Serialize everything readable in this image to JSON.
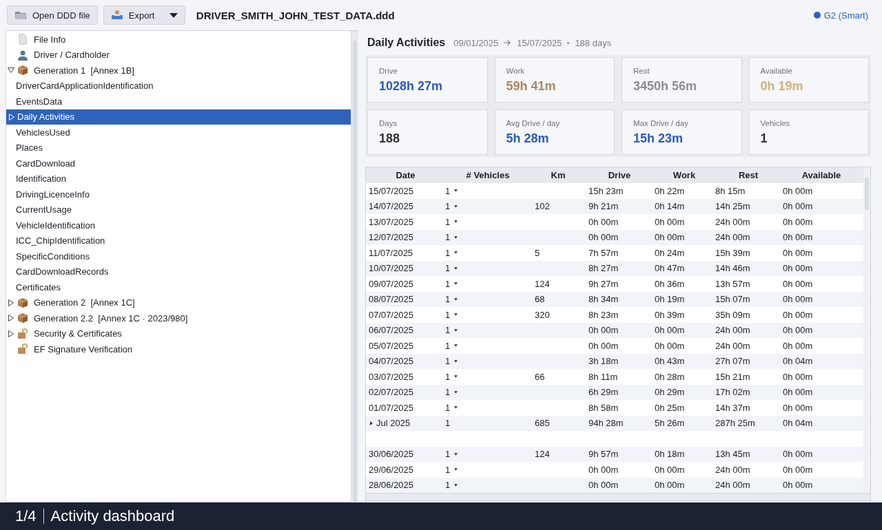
{
  "toolbar": {
    "buttons": [
      {
        "kind": "open",
        "label": "Open DDD file"
      },
      {
        "kind": "export",
        "label": "Export"
      }
    ],
    "file_name": "DRIVER_SMITH_JOHN_TEST_DATA.ddd",
    "card_type": {
      "label": "G2 (Smart)",
      "color": "#2a5fc4"
    }
  },
  "tree": [
    {
      "kind": "file",
      "label": "File Info",
      "selected": false
    },
    {
      "kind": "person",
      "label": "Driver / Cardholder",
      "selected": false
    },
    {
      "kind": "package",
      "label": "Generation 1  [Annex 1B]",
      "selected": false,
      "expanded": true,
      "children": [
        {
          "label": "DriverCardApplicationIdentification",
          "selected": false
        },
        {
          "label": "EventsData",
          "selected": false
        },
        {
          "label": "Daily Activities",
          "selected": true,
          "expanded": false
        },
        {
          "label": "VehiclesUsed",
          "selected": false
        },
        {
          "label": "Places",
          "selected": false
        },
        {
          "label": "CardDownload",
          "selected": false
        },
        {
          "label": "Identification",
          "selected": false
        },
        {
          "label": "DrivingLicenceInfo",
          "selected": false
        },
        {
          "label": "CurrentUsage",
          "selected": false
        },
        {
          "label": "VehicleIdentification",
          "selected": false
        },
        {
          "label": "ICC_ChipIdentification",
          "selected": false
        },
        {
          "label": "SpecificConditions",
          "selected": false
        },
        {
          "label": "CardDownloadRecords",
          "selected": false
        },
        {
          "label": "Certificates",
          "selected": false
        }
      ]
    },
    {
      "kind": "package",
      "label": "Generation 2  [Annex 1C]",
      "selected": false,
      "expanded": false
    },
    {
      "kind": "package",
      "label": "Generation 2.2  [Annex 1C · 2023/980]",
      "selected": false,
      "expanded": false
    },
    {
      "kind": "lock",
      "label": "Security & Certificates",
      "selected": false,
      "expanded": false
    },
    {
      "kind": "lock",
      "label": "EF Signature Verification",
      "selected": false
    }
  ],
  "summary": {
    "title": "Daily Activities",
    "range_start": "09/01/2025",
    "range_end": "15/07/2025",
    "days": "188 days"
  },
  "stats": [
    {
      "label": "Drive",
      "value": "1028h 27m",
      "color": "#2a5bb8"
    },
    {
      "label": "Work",
      "value": "59h 41m",
      "color": "#b08560"
    },
    {
      "label": "Rest",
      "value": "3450h 56m",
      "color": "#8a8f98"
    },
    {
      "label": "Available",
      "value": "0h 19m",
      "color": "#d2b07a"
    },
    {
      "label": "Days",
      "value": "188",
      "color": "#2b3038"
    },
    {
      "label": "Avg Drive / day",
      "value": "5h 28m",
      "color": "#2a5bb8"
    },
    {
      "label": "Max Drive / day",
      "value": "15h 23m",
      "color": "#2a5bb8"
    },
    {
      "label": "Vehicles",
      "value": "1",
      "color": "#2b3038"
    }
  ],
  "table": {
    "columns": [
      "Date",
      "# Vehicles",
      "Km",
      "Drive",
      "Work",
      "Rest",
      "Available"
    ],
    "rows": [
      {
        "kind": "day",
        "cells": [
          "15/07/2025",
          "1",
          "",
          "15h 23m",
          "0h 22m",
          "8h 15m",
          "0h 00m"
        ]
      },
      {
        "kind": "day",
        "cells": [
          "14/07/2025",
          "1",
          "102",
          "9h 21m",
          "0h 14m",
          "14h 25m",
          "0h 00m"
        ]
      },
      {
        "kind": "day",
        "cells": [
          "13/07/2025",
          "1",
          "",
          "0h 00m",
          "0h 00m",
          "24h 00m",
          "0h 00m"
        ]
      },
      {
        "kind": "day",
        "cells": [
          "12/07/2025",
          "1",
          "",
          "0h 00m",
          "0h 00m",
          "24h 00m",
          "0h 00m"
        ]
      },
      {
        "kind": "day",
        "cells": [
          "11/07/2025",
          "1",
          "5",
          "7h 57m",
          "0h 24m",
          "15h 39m",
          "0h 00m"
        ]
      },
      {
        "kind": "day",
        "cells": [
          "10/07/2025",
          "1",
          "",
          "8h 27m",
          "0h 47m",
          "14h 46m",
          "0h 00m"
        ]
      },
      {
        "kind": "day",
        "cells": [
          "09/07/2025",
          "1",
          "124",
          "9h 27m",
          "0h 36m",
          "13h 57m",
          "0h 00m"
        ]
      },
      {
        "kind": "day",
        "cells": [
          "08/07/2025",
          "1",
          "68",
          "8h 34m",
          "0h 19m",
          "15h 07m",
          "0h 00m"
        ]
      },
      {
        "kind": "day",
        "cells": [
          "07/07/2025",
          "1",
          "320",
          "8h 23m",
          "0h 39m",
          "35h 09m",
          "0h 00m"
        ]
      },
      {
        "kind": "day",
        "cells": [
          "06/07/2025",
          "1",
          "",
          "0h 00m",
          "0h 00m",
          "24h 00m",
          "0h 00m"
        ]
      },
      {
        "kind": "day",
        "cells": [
          "05/07/2025",
          "1",
          "",
          "0h 00m",
          "0h 00m",
          "24h 00m",
          "0h 00m"
        ]
      },
      {
        "kind": "day",
        "cells": [
          "04/07/2025",
          "1",
          "",
          "3h 18m",
          "0h 43m",
          "27h 07m",
          "0h 04m"
        ]
      },
      {
        "kind": "day",
        "cells": [
          "03/07/2025",
          "1",
          "66",
          "8h 11m",
          "0h 28m",
          "15h 21m",
          "0h 00m"
        ]
      },
      {
        "kind": "day",
        "cells": [
          "02/07/2025",
          "1",
          "",
          "6h 29m",
          "0h 29m",
          "17h 02m",
          "0h 00m"
        ]
      },
      {
        "kind": "day",
        "cells": [
          "01/07/2025",
          "1",
          "",
          "8h 58m",
          "0h 25m",
          "14h 37m",
          "0h 00m"
        ]
      },
      {
        "kind": "month",
        "cells": [
          "Jul 2025",
          "1",
          "685",
          "94h 28m",
          "5h 26m",
          "287h 25m",
          "0h 04m"
        ]
      },
      {
        "kind": "blank",
        "cells": []
      },
      {
        "kind": "day",
        "cells": [
          "30/06/2025",
          "1",
          "124",
          "9h 57m",
          "0h 18m",
          "13h 45m",
          "0h 00m"
        ]
      },
      {
        "kind": "day",
        "cells": [
          "29/06/2025",
          "1",
          "",
          "0h 00m",
          "0h 00m",
          "24h 00m",
          "0h 00m"
        ]
      },
      {
        "kind": "day",
        "cells": [
          "28/06/2025",
          "1",
          "",
          "0h 00m",
          "0h 00m",
          "24h 00m",
          "0h 00m"
        ]
      }
    ]
  },
  "footer": {
    "page": "1/4",
    "caption": "Activity dashboard"
  }
}
